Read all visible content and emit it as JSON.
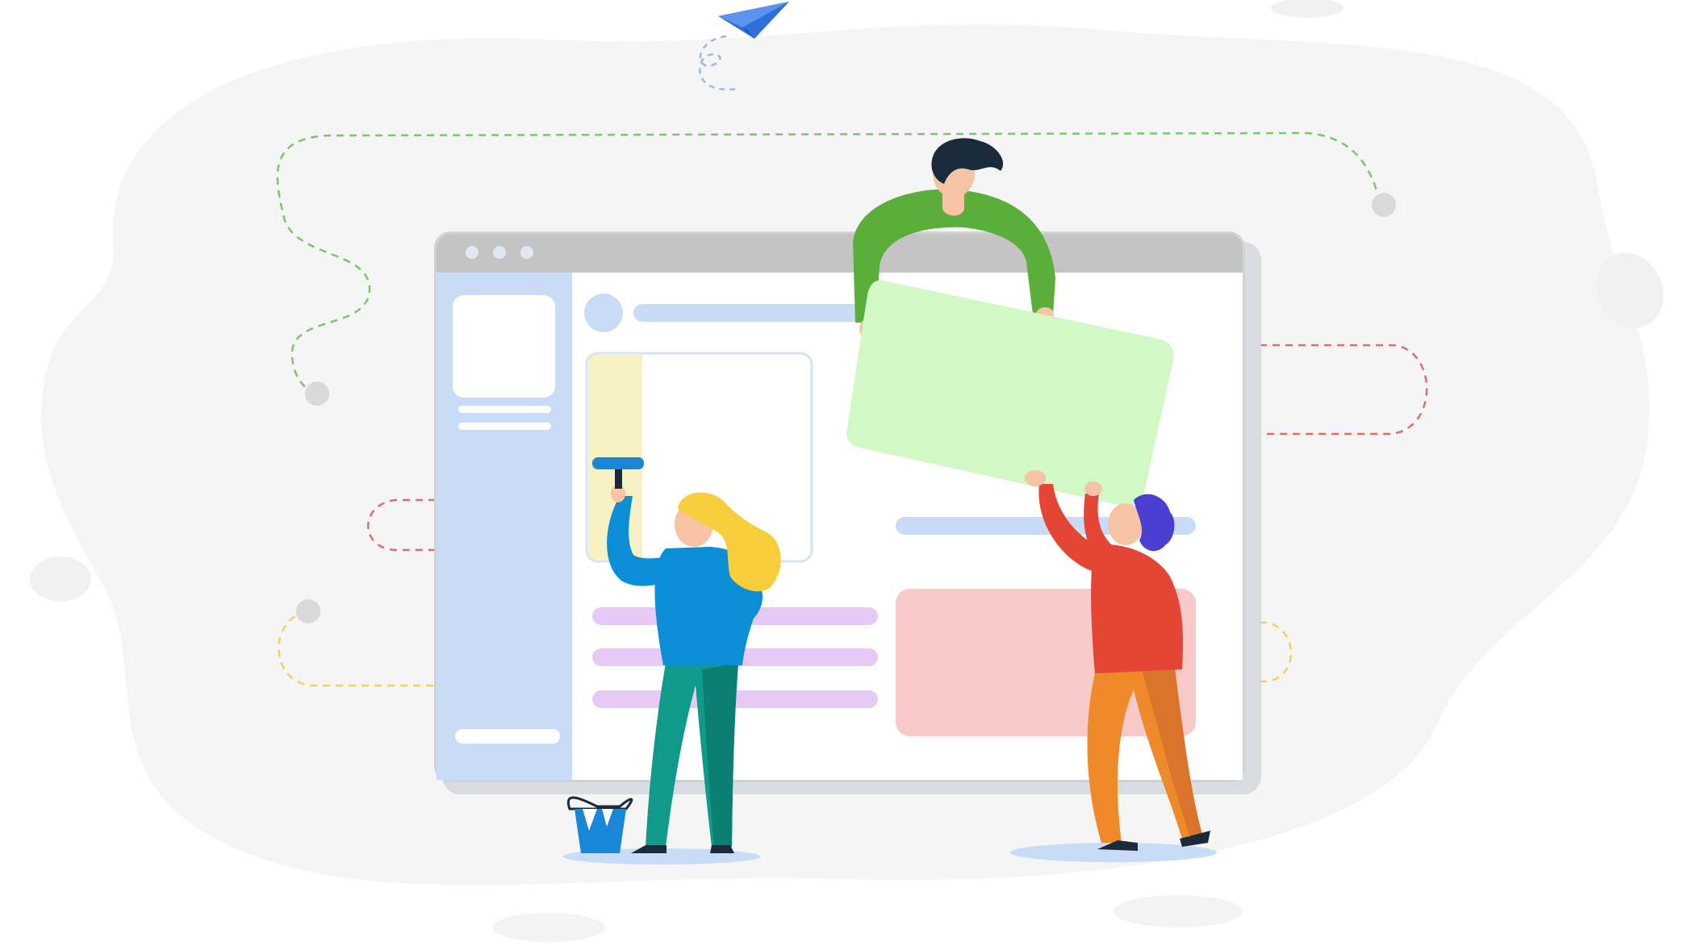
{
  "illustration": {
    "kind": "flat vector illustration",
    "has_visible_text": false
  },
  "colors": {
    "background": "#ffffff",
    "blob": "#f5f5f5",
    "window_frame": "#cfd3d8",
    "window_titlebar": "#c4c4c4",
    "window_body": "#ffffff",
    "sidebar": "#c8dbf7",
    "blue_placeholder": "#c8dbf7",
    "yellow_paint": "#f7f2c4",
    "purple_bars": "#e6c9f5",
    "green_card": "#d2f8c6",
    "pink_card": "#f7c9c9",
    "shirt_green": "#5aaf3a",
    "shirt_blue": "#0b8ed6",
    "shirt_red": "#e54535",
    "pants_teal": "#0f9a8a",
    "pants_orange": "#ef8a2b",
    "hair_blonde": "#f7cf3c",
    "hair_purple": "#4b3fd1",
    "hair_dark": "#1b2a3a",
    "skin": "#f6c3a4",
    "bucket_blue": "#1a86d6",
    "paper_plane": "#2f6fdc",
    "dash_green": "#7cc56e",
    "dash_red": "#e36b6b",
    "dash_yellow": "#f2cf63",
    "dash_blue": "#9fb6df",
    "dot_grey": "#d9d9d9"
  },
  "icons": [
    "paper-plane-icon",
    "paint-roller-icon",
    "paint-bucket-icon",
    "window-control-dots-icon"
  ]
}
